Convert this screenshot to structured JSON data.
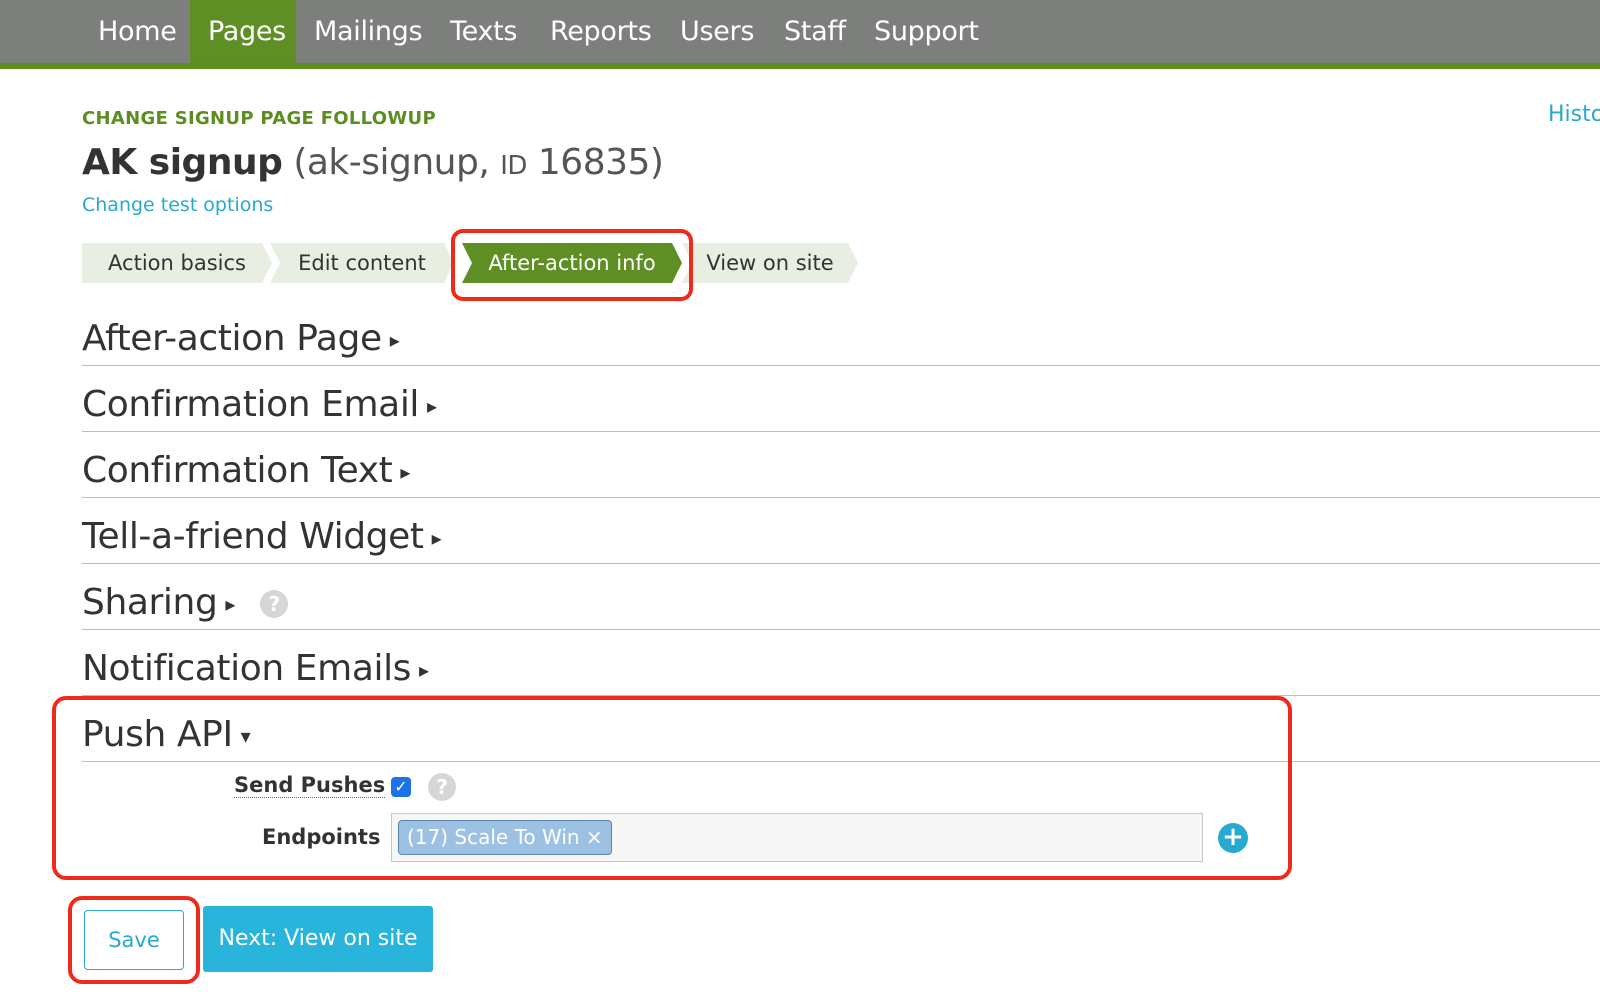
{
  "nav": {
    "items": [
      {
        "label": "Home"
      },
      {
        "label": "Pages"
      },
      {
        "label": "Mailings"
      },
      {
        "label": "Texts"
      },
      {
        "label": "Reports"
      },
      {
        "label": "Users"
      },
      {
        "label": "Staff"
      },
      {
        "label": "Support"
      }
    ],
    "active": "Pages"
  },
  "header": {
    "kicker": "CHANGE SIGNUP PAGE FOLLOWUP",
    "history_link": "Histo",
    "title_bold": "AK signup",
    "title_short": "(ak-signup,",
    "id_label": "ID",
    "id_value": "16835)",
    "test_link": "Change test options"
  },
  "steps": [
    {
      "label": "Action basics"
    },
    {
      "label": "Edit content"
    },
    {
      "label": "After-action info"
    },
    {
      "label": "View on site"
    }
  ],
  "active_step": "After-action info",
  "sections": [
    {
      "title": "After-action Page",
      "caret": "▸"
    },
    {
      "title": "Confirmation Email",
      "caret": "▸"
    },
    {
      "title": "Confirmation Text",
      "caret": "▸"
    },
    {
      "title": "Tell-a-friend Widget",
      "caret": "▸"
    },
    {
      "title": "Sharing",
      "caret": "▸",
      "help": "?"
    },
    {
      "title": "Notification Emails",
      "caret": "▸"
    },
    {
      "title": "Push API",
      "caret": "▾"
    }
  ],
  "push_api": {
    "send_pushes_label": "Send Pushes",
    "send_pushes_checked": "✓",
    "help": "?",
    "endpoints_label": "Endpoints",
    "endpoint_token": "(17) Scale To Win",
    "token_remove": "×",
    "add_icon": "+"
  },
  "buttons": {
    "save": "Save",
    "next": "Next: View on site"
  },
  "colors": {
    "nav_bg": "#7d7f7d",
    "brand_green": "#5e8f24",
    "link_blue": "#28a9cf",
    "highlight_red": "#ee2a1b"
  }
}
